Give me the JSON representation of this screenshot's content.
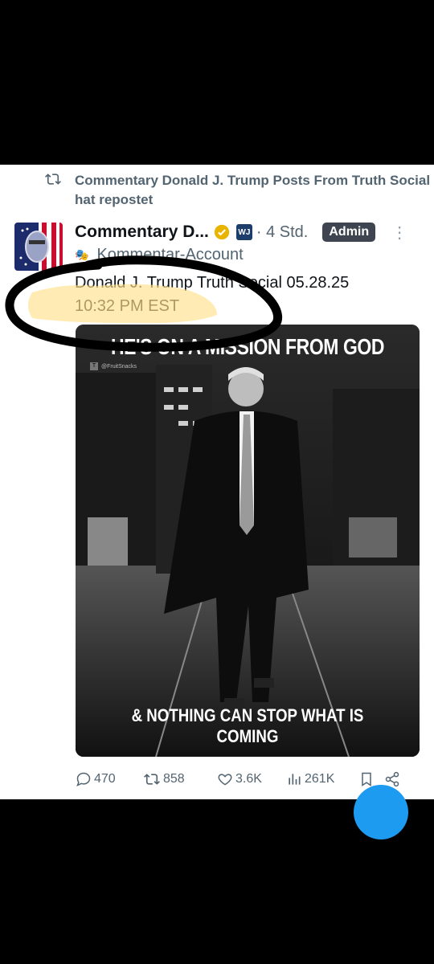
{
  "repost": {
    "icon": "repost-icon",
    "text": "Commentary Donald J. Trump Posts From Truth Social hat repostet"
  },
  "author": {
    "name": "Commentary D...",
    "verified_icon": "gold-check-icon",
    "affiliate_badge": "WJ",
    "time": "· 4 Std.",
    "admin_badge": "Admin",
    "subtitle": "Kommentar-Account",
    "subtitle_icon": "mask-icon"
  },
  "post": {
    "line1": "Donald J. Trump Truth Social 05.28.25",
    "line2": "10:32 PM EST"
  },
  "meme": {
    "top_text": "HE'S ON A MISSION FROM GOD",
    "bottom_text": "& NOTHING CAN STOP WHAT IS COMING",
    "watermark": "@FruitSnacks"
  },
  "actions": {
    "replies": "470",
    "reposts": "858",
    "likes": "3.6K",
    "views": "261K"
  },
  "colors": {
    "accent": "#1d9bf0",
    "muted": "#536471",
    "highlight": "#ffe08a",
    "admin_bg": "#3f4550"
  }
}
